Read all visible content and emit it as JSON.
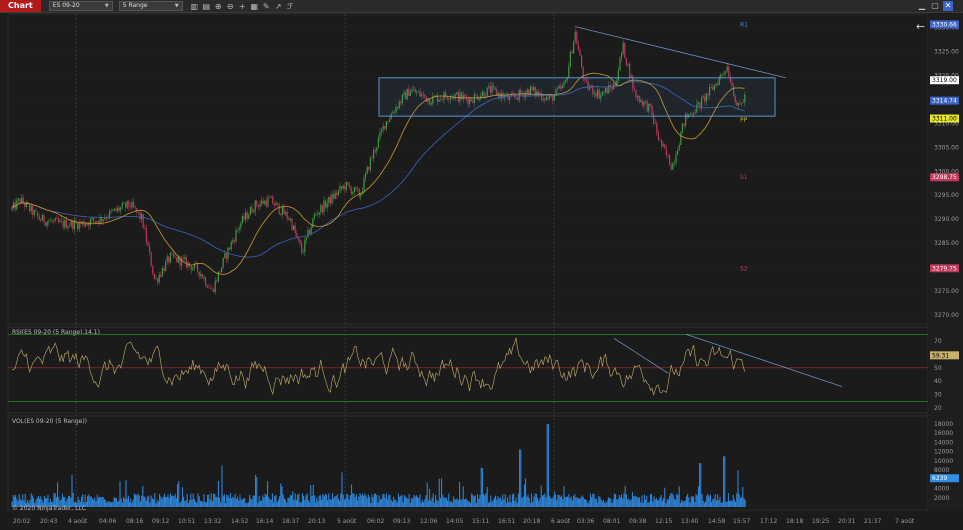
{
  "toolbar": {
    "tab_label": "Chart",
    "instrument": "ES 09-20",
    "period": "5 Range",
    "icons": [
      "bar-type-icon",
      "series-icon",
      "zoom-in-icon",
      "zoom-out-icon",
      "crosshair-icon",
      "properties-icon",
      "drawing-tools-icon",
      "arrow-icon",
      "indicators-icon"
    ]
  },
  "colors": {
    "background": "#1b1b1b",
    "grid": "#2b2b2b",
    "up_candle": "#3f9a3f",
    "down_candle": "#c0395a",
    "sma_fast": "#c99a2e",
    "sma_slow": "#3a64c8",
    "rectangle": "#5ba3e6",
    "rsi_line": "#c9b06a",
    "rsi_upper": "#2e9a2e",
    "rsi_lower": "#2e9a2e",
    "rsi_mid": "#a82d2d",
    "volume": "#2f8ee6",
    "pivot_r": "#4a8ae6",
    "pivot_s": "#c0395a",
    "pivot_pp": "#c9b02e"
  },
  "price_pane": {
    "y_ticks": [
      "3330.00",
      "3325.00",
      "3320.00",
      "3315.00",
      "3310.00",
      "3305.00",
      "3300.00",
      "3295.00",
      "3290.00",
      "3285.00",
      "3280.00",
      "3275.00",
      "3270.00"
    ],
    "tags": [
      {
        "label": "3330.66",
        "bg": "#3a64c8",
        "fg": "#ffffff"
      },
      {
        "label": "3319.00",
        "bg": "#ffffff",
        "fg": "#000000"
      },
      {
        "label": "3314.74",
        "bg": "#3a64c8",
        "fg": "#ffffff"
      },
      {
        "label": "3311.00",
        "bg": "#e6e62e",
        "fg": "#000000"
      },
      {
        "label": "3298.75",
        "bg": "#c0395a",
        "fg": "#ffffff"
      },
      {
        "label": "3279.75",
        "bg": "#c0395a",
        "fg": "#ffffff"
      }
    ],
    "pivots": [
      {
        "label": "R1",
        "color": "#4a8ae6"
      },
      {
        "label": "PP",
        "color": "#c9b02e"
      },
      {
        "label": "S1",
        "color": "#c0395a"
      },
      {
        "label": "S2",
        "color": "#c0395a"
      }
    ]
  },
  "rsi_pane": {
    "title": "RSI(ES 09-20 (5 Range),14,1)",
    "y_ticks": [
      "70",
      "60",
      "50",
      "40",
      "30",
      "20"
    ],
    "tag": "59.31"
  },
  "vol_pane": {
    "title": "VOL(ES 09-20 (5 Range))",
    "y_ticks": [
      "18000",
      "16000",
      "14000",
      "12000",
      "10000",
      "8000",
      "6000",
      "4000",
      "2000"
    ],
    "tag": "6239"
  },
  "x_axis": {
    "labels": [
      "20:02",
      "20:43",
      "4 août",
      "04:06",
      "08:16",
      "09:12",
      "10:51",
      "13:32",
      "14:52",
      "16:14",
      "18:37",
      "20:13",
      "5 août",
      "06:02",
      "09:13",
      "12:06",
      "14:05",
      "15:11",
      "16:51",
      "20:18",
      "6 août",
      "03:36",
      "08:01",
      "09:38",
      "12:15",
      "13:40",
      "14:58",
      "15:57",
      "17:12",
      "18:18",
      "19:25",
      "20:31",
      "21:37",
      "7 août"
    ]
  },
  "copyright": "© 2020 NinjaTrader, LLC"
}
